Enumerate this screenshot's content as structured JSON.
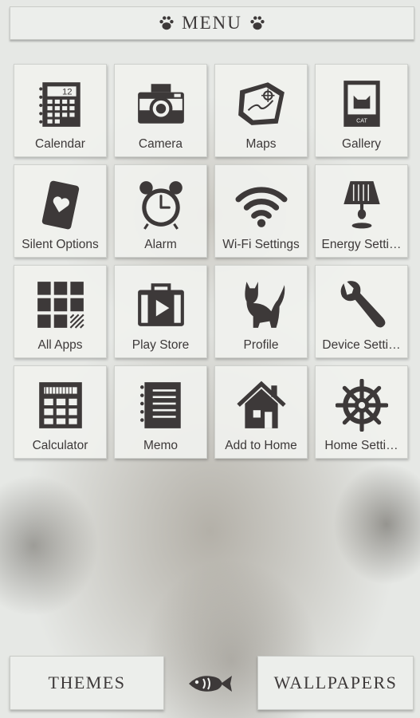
{
  "header": {
    "title": "MENU"
  },
  "apps": [
    {
      "label": "Calendar",
      "icon": "calendar-icon"
    },
    {
      "label": "Camera",
      "icon": "camera-icon"
    },
    {
      "label": "Maps",
      "icon": "map-icon"
    },
    {
      "label": "Gallery",
      "icon": "cat-frame-icon",
      "icon_text": "CAT"
    },
    {
      "label": "Silent Options",
      "icon": "phone-heart-icon"
    },
    {
      "label": "Alarm",
      "icon": "alarm-clock-icon"
    },
    {
      "label": "Wi-Fi Settings",
      "icon": "wifi-icon"
    },
    {
      "label": "Energy Setti…",
      "icon": "lamp-icon"
    },
    {
      "label": "All Apps",
      "icon": "app-grid-icon"
    },
    {
      "label": "Play Store",
      "icon": "play-bag-icon"
    },
    {
      "label": "Profile",
      "icon": "cat-silhouette-icon"
    },
    {
      "label": "Device Setti…",
      "icon": "wrench-icon"
    },
    {
      "label": "Calculator",
      "icon": "calculator-icon"
    },
    {
      "label": "Memo",
      "icon": "notebook-icon"
    },
    {
      "label": "Add to Home",
      "icon": "house-icon"
    },
    {
      "label": "Home Setti…",
      "icon": "ship-wheel-icon"
    }
  ],
  "calendar_day": "12",
  "footer": {
    "themes_label": "THEMES",
    "wallpapers_label": "WALLPAPERS",
    "center_icon": "fish-icon"
  },
  "colors": {
    "icon": "#3d3939",
    "tile": "#f0f1ee",
    "background": "#e6e8e5"
  }
}
